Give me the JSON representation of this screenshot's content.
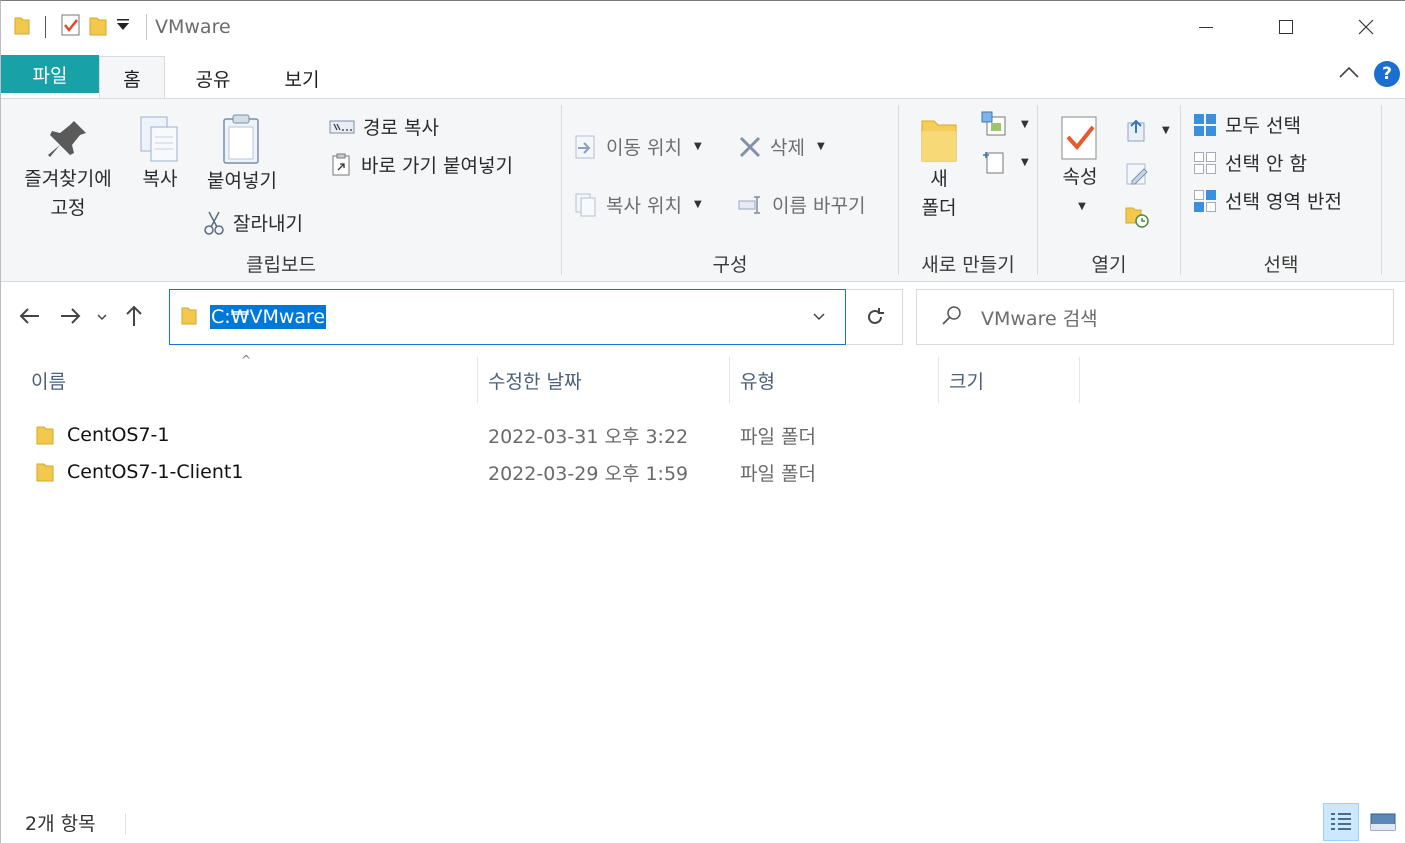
{
  "window": {
    "title": "VMware",
    "minimize_glyph": "—",
    "maximize_glyph": "☐",
    "close_glyph": "✕"
  },
  "tabs": {
    "file": "파일",
    "home": "홈",
    "share": "공유",
    "view": "보기"
  },
  "ribbon": {
    "clipboard": {
      "label": "클립보드",
      "pin_line1": "즐겨찾기에",
      "pin_line2": "고정",
      "copy": "복사",
      "paste": "붙여넣기",
      "copy_path": "경로 복사",
      "paste_shortcut": "바로 가기 붙여넣기",
      "cut": "잘라내기"
    },
    "organize": {
      "label": "구성",
      "move_to": "이동 위치",
      "copy_to": "복사 위치",
      "delete": "삭제",
      "rename": "이름 바꾸기"
    },
    "new": {
      "label": "새로 만들기",
      "new_folder_line1": "새",
      "new_folder_line2": "폴더"
    },
    "open": {
      "label": "열기",
      "properties": "속성"
    },
    "select": {
      "label": "선택",
      "select_all": "모두 선택",
      "select_none": "선택 안 함",
      "invert": "선택 영역 반전"
    }
  },
  "address": {
    "path": "C:₩VMware"
  },
  "search": {
    "placeholder": "VMware 검색"
  },
  "columns": {
    "name": "이름",
    "date": "수정한 날짜",
    "type": "유형",
    "size": "크기"
  },
  "files": [
    {
      "name": "CentOS7-1",
      "date": "2022-03-31 오후 3:22",
      "type": "파일 폴더"
    },
    {
      "name": "CentOS7-1-Client1",
      "date": "2022-03-29 오후 1:59",
      "type": "파일 폴더"
    }
  ],
  "status": {
    "count": "2개 항목"
  },
  "colors": {
    "file_tab": "#19a1a8",
    "accent": "#0078d7",
    "folder": "#f2c94c"
  }
}
